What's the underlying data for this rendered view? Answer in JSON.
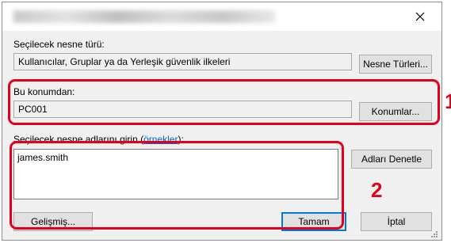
{
  "dialog": {
    "close_label": "×"
  },
  "object_type": {
    "label": "Seçilecek nesne türü:",
    "value": "Kullanıcılar, Gruplar ya da Yerleşik güvenlik ilkeleri",
    "button": "Nesne Türleri..."
  },
  "location": {
    "label": "Bu konumdan:",
    "value": "PC001",
    "button": "Konumlar..."
  },
  "object_names": {
    "label_prefix": "Seçilecek nesne adlarını girin (",
    "label_link": "örnekler",
    "label_suffix": "):",
    "value": "james.smith",
    "check_button": "Adları Denetle"
  },
  "footer": {
    "advanced_button": "Gelişmiş...",
    "ok_button": "Tamam",
    "cancel_button": "İptal"
  },
  "annotations": {
    "callout_1": "1",
    "callout_2": "2",
    "highlight_color": "#e4001b"
  }
}
